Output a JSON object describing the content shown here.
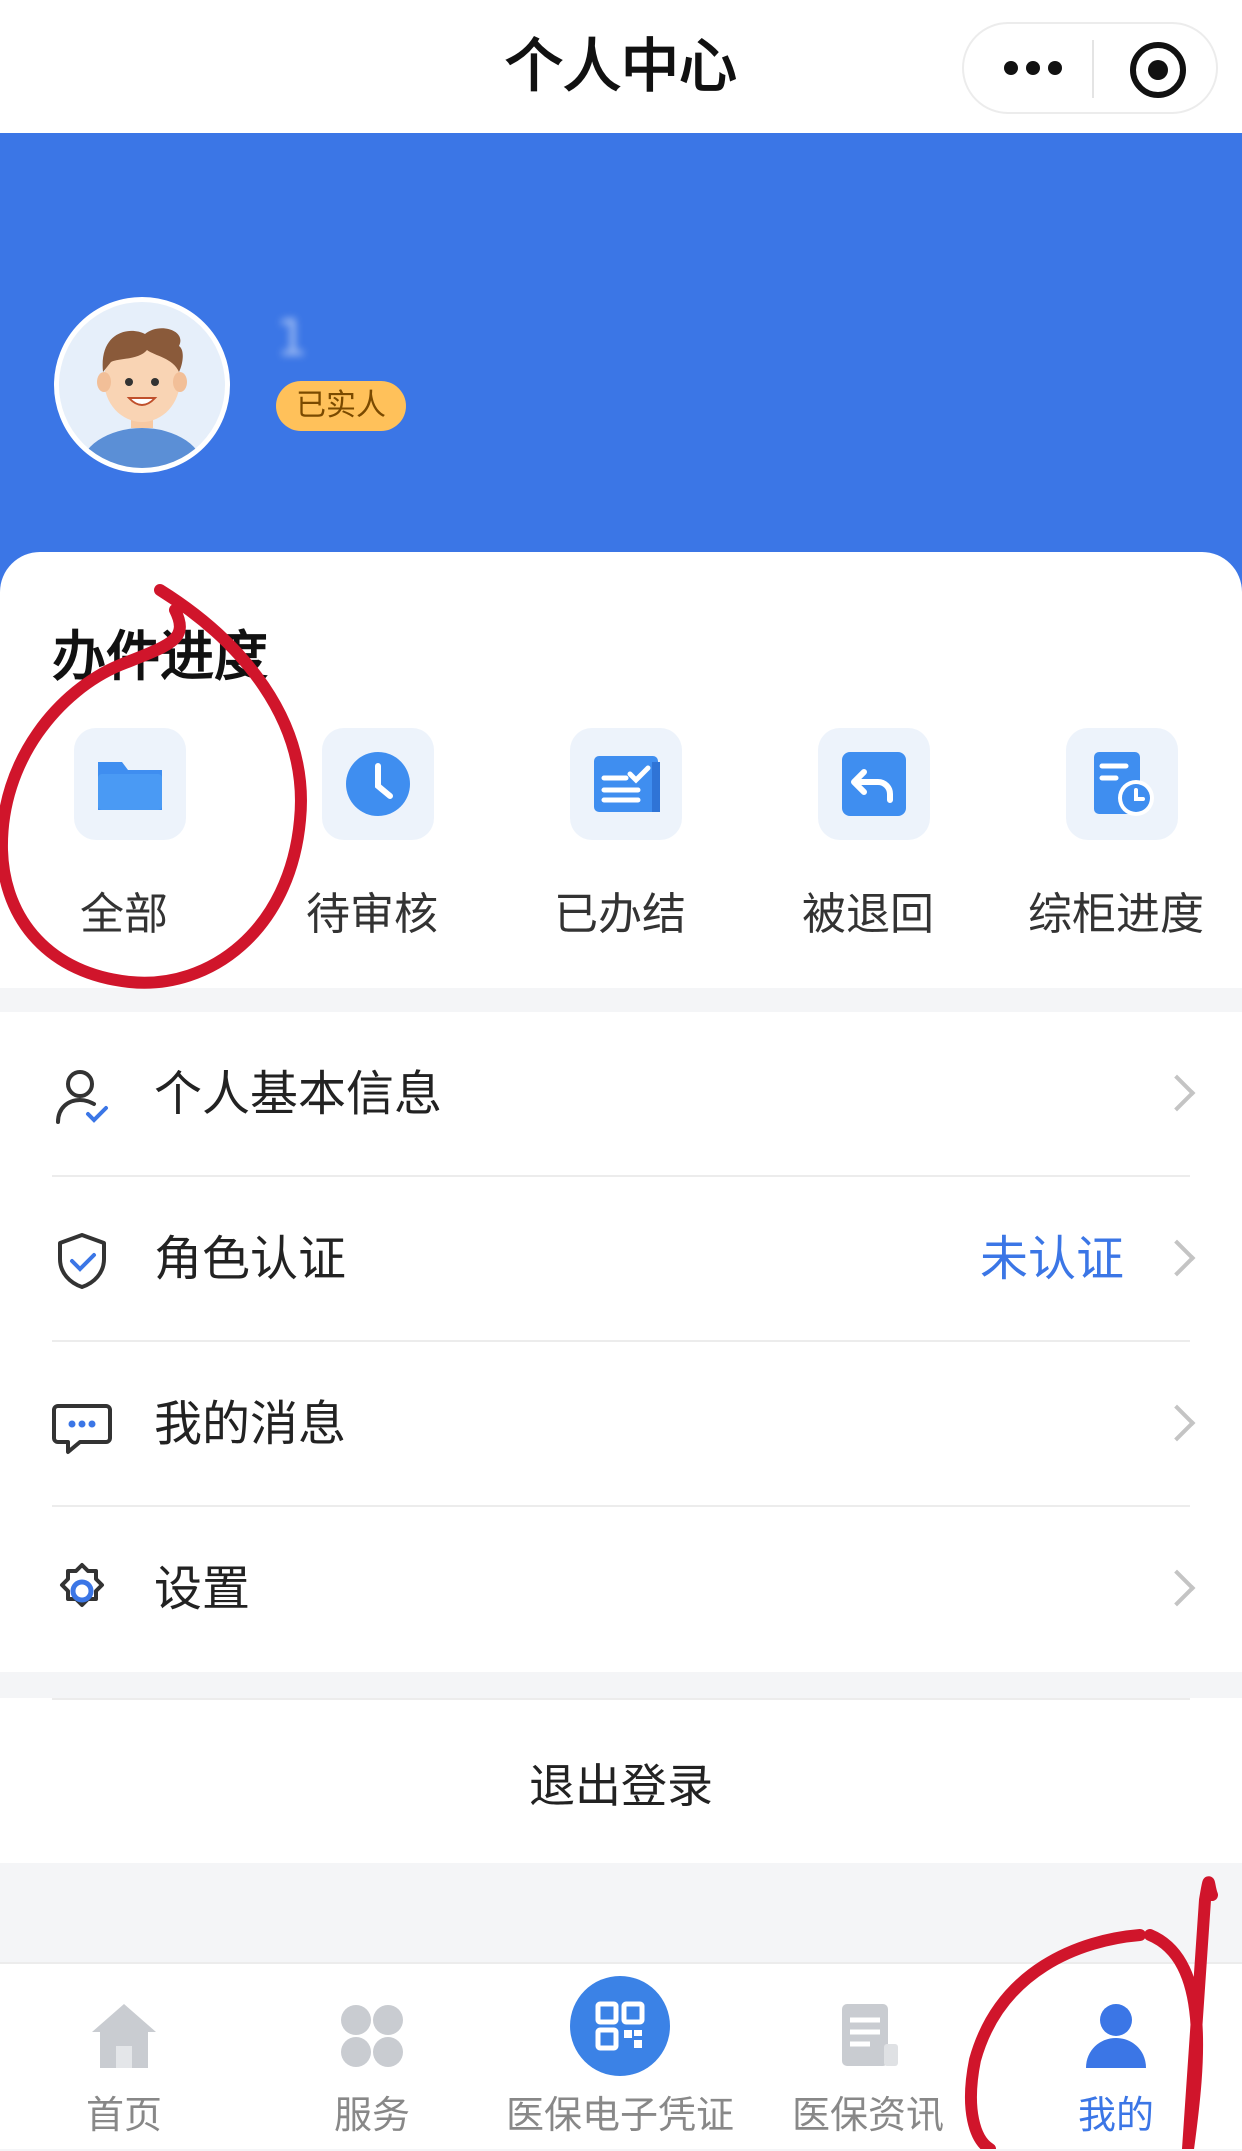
{
  "nav": {
    "title": "个人中心"
  },
  "profile": {
    "phone_masked": "1",
    "badge": "已实人"
  },
  "progress": {
    "title": "办件进度",
    "items": [
      {
        "label": "全部",
        "icon": "folder-icon"
      },
      {
        "label": "待审核",
        "icon": "clock-icon"
      },
      {
        "label": "已办结",
        "icon": "completed-list-icon"
      },
      {
        "label": "被退回",
        "icon": "return-icon"
      },
      {
        "label": "综柜进度",
        "icon": "document-clock-icon"
      }
    ]
  },
  "menu": {
    "items": [
      {
        "label": "个人基本信息",
        "icon": "user-check-icon",
        "status": ""
      },
      {
        "label": "角色认证",
        "icon": "shield-check-icon",
        "status": "未认证"
      },
      {
        "label": "我的消息",
        "icon": "message-icon",
        "status": ""
      },
      {
        "label": "设置",
        "icon": "gear-icon",
        "status": ""
      }
    ]
  },
  "logout": {
    "label": "退出登录"
  },
  "tabbar": {
    "items": [
      {
        "label": "首页",
        "icon": "home-icon",
        "active": false
      },
      {
        "label": "服务",
        "icon": "grid-icon",
        "active": false
      },
      {
        "label": "医保电子凭证",
        "icon": "qr-code-icon",
        "active": false
      },
      {
        "label": "医保资讯",
        "icon": "news-icon",
        "active": false
      },
      {
        "label": "我的",
        "icon": "person-icon",
        "active": true
      }
    ]
  },
  "colors": {
    "primary": "#3b76e6",
    "badge_bg": "#ffc15a",
    "annotation": "#d0152b",
    "inactive_tab": "#888888"
  }
}
